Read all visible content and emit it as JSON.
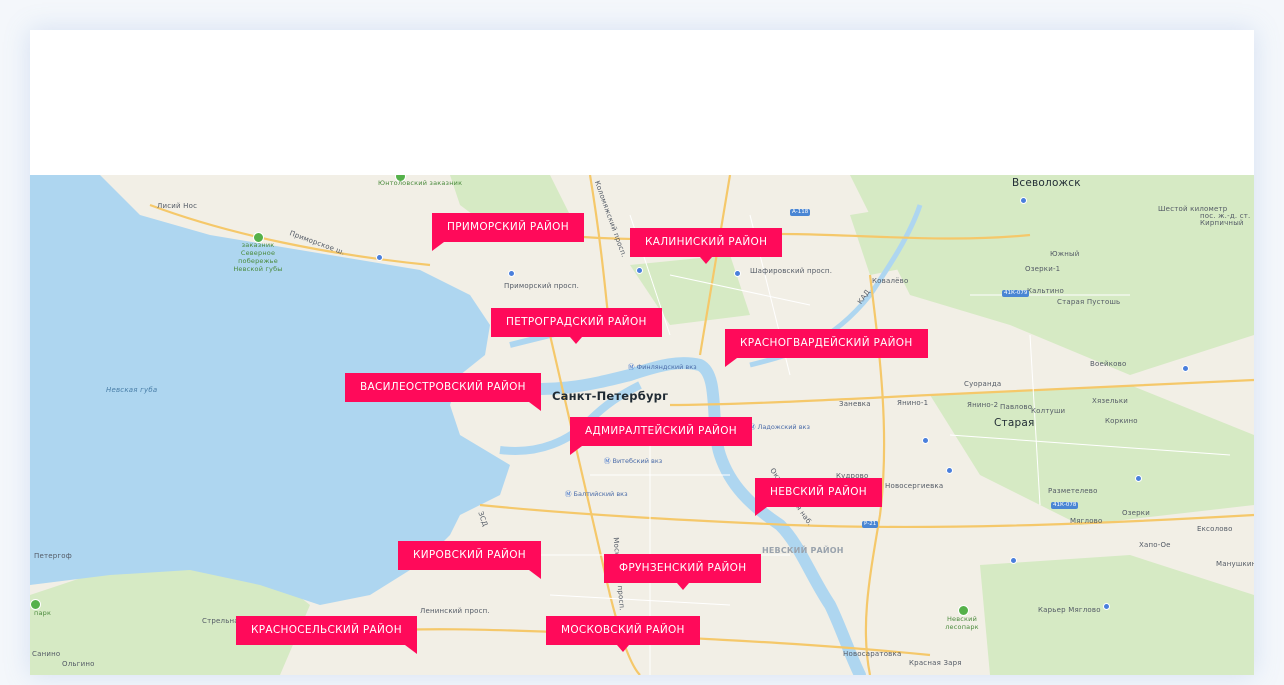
{
  "map": {
    "city_label": "Санкт-Петербург",
    "water_label": "Невская губа",
    "districts": [
      "ПРИМОРСКИЙ РАЙОН",
      "КАЛИНИСКИЙ РАЙОН",
      "ПЕТРОГРАДСКИЙ РАЙОН",
      "КРАСНОГВАРДЕЙСКИЙ РАЙОН",
      "ВАСИЛЕОСТРОВСКИЙ РАЙОН",
      "АДМИРАЛТЕЙСКИЙ РАЙОН",
      "НЕВСКИЙ РАЙОН",
      "КИРОВСКИЙ РАЙОН",
      "ФРУНЗЕНСКИЙ РАЙОН",
      "КРАСНОСЕЛЬСКИЙ РАЙОН",
      "МОСКОВСКИЙ РАЙОН"
    ],
    "places": {
      "vsevolozhsk": "Всеволожск",
      "lisiy_nos": "Лисий Нос",
      "peterhof": "Петергоф",
      "strelna": "Стрельна",
      "yanino": "Янино-1",
      "staraya": "Старая",
      "kovalevo": "Ковалёво",
      "suoranda": "Суоранда",
      "yanino2": "Янино-2",
      "pavlovo": "Павлово",
      "koltushi": "Колтуши",
      "razmetelevo": "Разметелево",
      "voeikovo": "Воейково",
      "kaltino": "Кальтино",
      "starye_pustosh": "Старая Пустошь",
      "ozerki": "Озерки",
      "eksolovo": "Ексолово",
      "khapo": "Хапо-Ое",
      "manushkino": "Манушкино",
      "karyer": "Карьер Мяглово",
      "myaglovo": "Мяглово",
      "novosaratovka": "Новосаратовка",
      "krasnaya_zarya": "Красная Заря",
      "zanevka": "Заневка",
      "kudrovo": "Кудрово",
      "novoserg": "Новосергиевка",
      "ozerki2": "Озерки-1",
      "kirpichnoe": "пос. ж.-д. ст. Кирпичный",
      "yuzhny": "Южный",
      "hiraz": "Хязельки",
      "korkino": "Коркино",
      "shestoy": "Шестой километр",
      "sanino": "Санино",
      "olgino": "Ольгино"
    },
    "parks": {
      "yuntolovo": "Юнтоловский заказник",
      "severnoye": "заказник Северное побережье Невской губы",
      "nevsky_lesopark": "Невский лесопарк",
      "park": "парк"
    },
    "metro": {
      "finlyandsky": "Финляндский вкз",
      "vitebsky": "Витебский вкз",
      "baltiysky": "Балтийский вкз",
      "ladozhsky": "Ладожский вкз"
    },
    "streets": {
      "primorsky": "Приморский просп.",
      "primorskoe": "Приморское ш.",
      "kad": "КАД",
      "zsd": "ЗСД",
      "shafirovsky": "Шафировский просп.",
      "kolomyazhsky": "Коломяжский просп.",
      "moskovsky": "Московский просп.",
      "oktyabrskaya": "Октябрьская наб.",
      "leninsky": "Ленинский просп."
    },
    "highways": [
      "А-118",
      "А-118",
      "Р-21",
      "41К-079",
      "41К-078"
    ],
    "muted_district": "НЕВСКИЙ РАЙОН"
  }
}
